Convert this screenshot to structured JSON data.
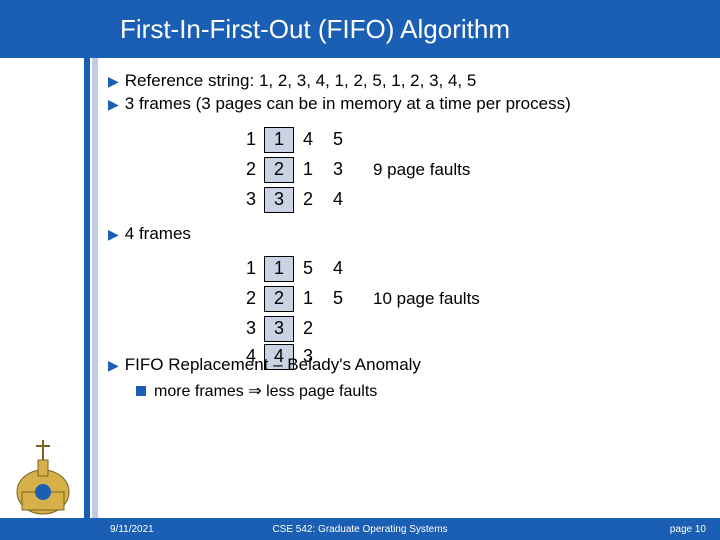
{
  "title": "First-In-First-Out (FIFO) Algorithm",
  "bullets": {
    "ref": "Reference string: 1, 2, 3, 4, 1, 2, 5, 1, 2, 3, 4, 5",
    "three": "3 frames (3 pages can be in memory at a time per process)",
    "four": "4 frames",
    "belady": "FIFO Replacement – Belady's Anomaly",
    "sub": "more frames ⇒ less page faults"
  },
  "t1": {
    "r1": {
      "lead": "1",
      "box": "1",
      "c": [
        "4",
        "5"
      ]
    },
    "r2": {
      "lead": "2",
      "box": "2",
      "c": [
        "1",
        "3"
      ],
      "note": "9 page faults"
    },
    "r3": {
      "lead": "3",
      "box": "3",
      "c": [
        "2",
        "4"
      ]
    }
  },
  "t2": {
    "r1": {
      "lead": "1",
      "box": "1",
      "c": [
        "5",
        "4"
      ]
    },
    "r2": {
      "lead": "2",
      "box": "2",
      "c": [
        "1",
        "5"
      ],
      "note": "10 page faults"
    },
    "r3": {
      "lead": "3",
      "box": "3",
      "c": [
        "2"
      ]
    },
    "r4": {
      "lead": "4",
      "box": "4",
      "c": [
        "3"
      ]
    }
  },
  "footer": {
    "left": "9/11/2021",
    "center": "CSE 542: Graduate Operating Systems",
    "right": "page 10"
  }
}
